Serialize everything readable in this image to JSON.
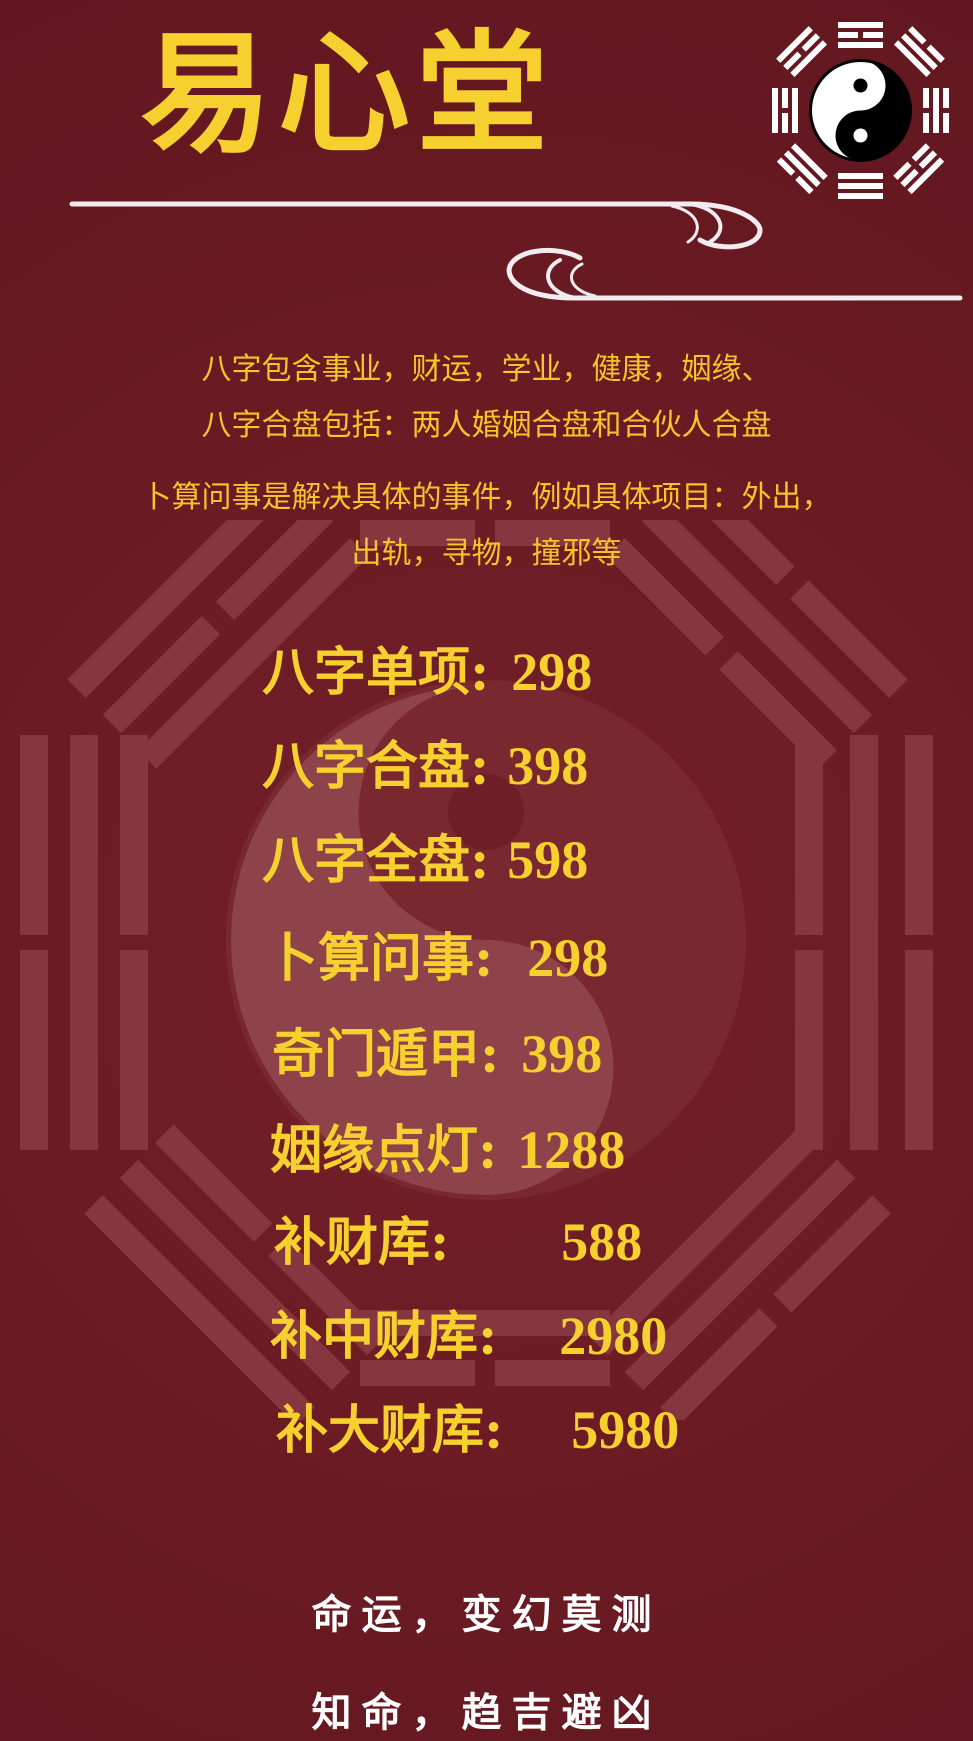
{
  "header": {
    "title": "易心堂"
  },
  "intro": {
    "line1": "八字包含事业，财运，学业，健康，姻缘、",
    "line2": "八字合盘包括：两人婚姻合盘和合伙人合盘",
    "line3": "卜算问事是解决具体的事件，例如具体项目：外出，",
    "line4": "出轨，寻物，撞邪等"
  },
  "prices": [
    {
      "label": "八字单项:",
      "value": "298"
    },
    {
      "label": "八字合盘:",
      "value": "398"
    },
    {
      "label": "八字全盘:",
      "value": "598"
    },
    {
      "label": "卜算问事:",
      "value": "298"
    },
    {
      "label": "奇门遁甲:",
      "value": "398"
    },
    {
      "label": "姻缘点灯:",
      "value": "1288"
    },
    {
      "label": "补财库:",
      "value": "588"
    },
    {
      "label": "补中财库:",
      "value": "2980"
    },
    {
      "label": "补大财库:",
      "value": "5980"
    }
  ],
  "footer": {
    "line1": "命运，变幻莫测",
    "line2": "知命，趋吉避凶"
  },
  "colors": {
    "background": "#6a1a22",
    "gold": "#f5d02e",
    "text_white": "#ffffff"
  },
  "icons": {
    "top_right": "bagua-yinyang-icon",
    "background": "bagua-watermark-icon",
    "divider": "cloud-scroll-line"
  }
}
